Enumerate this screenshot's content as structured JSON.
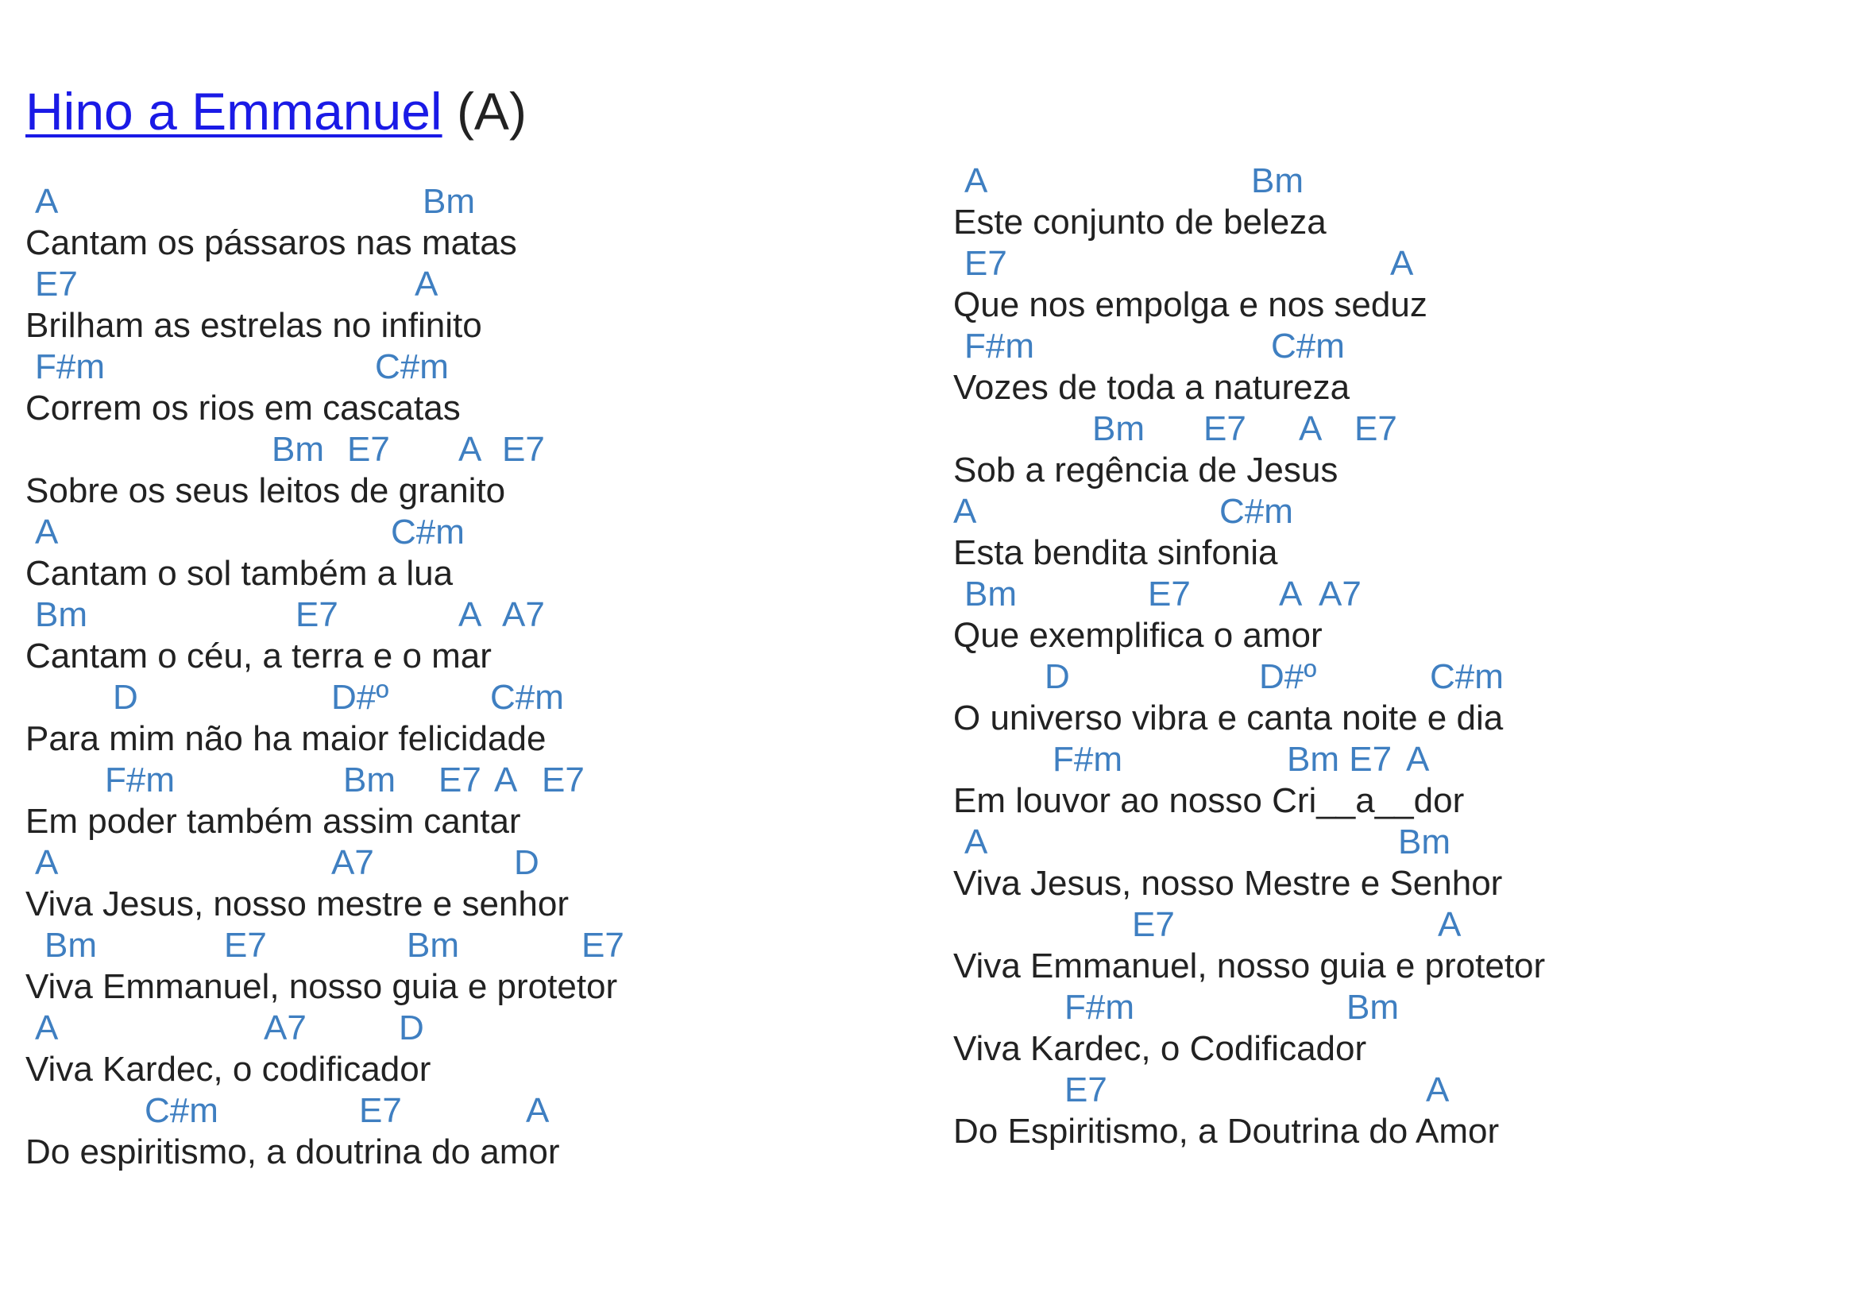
{
  "song": {
    "title": "Hino a Emmanuel",
    "key": "(A)"
  },
  "colors": {
    "chord": "#3f7fc1",
    "link": "#1a1ae6",
    "text": "#222222"
  },
  "left": [
    {
      "chords": [
        "A",
        "Bm"
      ],
      "lyric": "Cantam os pássaros nas matas"
    },
    {
      "chords": [
        "E7",
        "A"
      ],
      "lyric": "Brilham as estrelas no infinito"
    },
    {
      "chords": [
        "F#m",
        "C#m"
      ],
      "lyric": "Correm os rios em cascatas"
    },
    {
      "chords": [
        "Bm",
        "E7",
        "A",
        "E7"
      ],
      "lyric": "Sobre os seus leitos de granito"
    },
    {
      "chords": [
        "A",
        "C#m"
      ],
      "lyric": "Cantam o sol também a lua"
    },
    {
      "chords": [
        "Bm",
        "E7",
        "A",
        "A7"
      ],
      "lyric": "Cantam o céu, a terra e o mar"
    },
    {
      "chords": [
        "D",
        "D#º",
        "C#m"
      ],
      "lyric": "Para mim não ha maior felicidade"
    },
    {
      "chords": [
        "F#m",
        "Bm",
        "E7",
        "A",
        "E7"
      ],
      "lyric": "Em poder também assim cantar"
    },
    {
      "chords": [
        "A",
        "A7",
        "D"
      ],
      "lyric": "Viva Jesus, nosso mestre e senhor"
    },
    {
      "chords": [
        "Bm",
        "E7",
        "Bm",
        "E7"
      ],
      "lyric": "Viva Emmanuel, nosso guia e protetor"
    },
    {
      "chords": [
        "A",
        "A7",
        "D"
      ],
      "lyric": "Viva Kardec, o codificador"
    },
    {
      "chords": [
        "C#m",
        "E7",
        "A"
      ],
      "lyric": "Do espiritismo, a doutrina do amor"
    }
  ],
  "right": [
    {
      "chords": [
        "A",
        "Bm"
      ],
      "lyric": "Este conjunto de beleza"
    },
    {
      "chords": [
        "E7",
        "A"
      ],
      "lyric": "Que nos empolga e nos seduz"
    },
    {
      "chords": [
        "F#m",
        "C#m"
      ],
      "lyric": "Vozes de toda a natureza"
    },
    {
      "chords": [
        "Bm",
        "E7",
        "A",
        "E7"
      ],
      "lyric": "Sob a regência de Jesus"
    },
    {
      "chords": [
        "A",
        "C#m"
      ],
      "lyric": "Esta bendita sinfonia"
    },
    {
      "chords": [
        "Bm",
        "E7",
        "A",
        "A7"
      ],
      "lyric": "Que exemplifica o amor"
    },
    {
      "chords": [
        "D",
        "D#º",
        "C#m"
      ],
      "lyric": "O universo vibra e canta noite e dia"
    },
    {
      "chords": [
        "F#m",
        "Bm E7",
        "A"
      ],
      "lyric": "Em louvor ao nosso Cri__a__dor"
    },
    {
      "chords": [
        "A",
        "Bm"
      ],
      "lyric": "Viva Jesus, nosso Mestre e Senhor"
    },
    {
      "chords": [
        "E7",
        "A"
      ],
      "lyric": "Viva Emmanuel, nosso guia e protetor"
    },
    {
      "chords": [
        "F#m",
        "Bm"
      ],
      "lyric": "Viva Kardec, o Codificador"
    },
    {
      "chords": [
        "E7",
        "A"
      ],
      "lyric": "Do Espiritismo, a Doutrina do Amor"
    }
  ]
}
